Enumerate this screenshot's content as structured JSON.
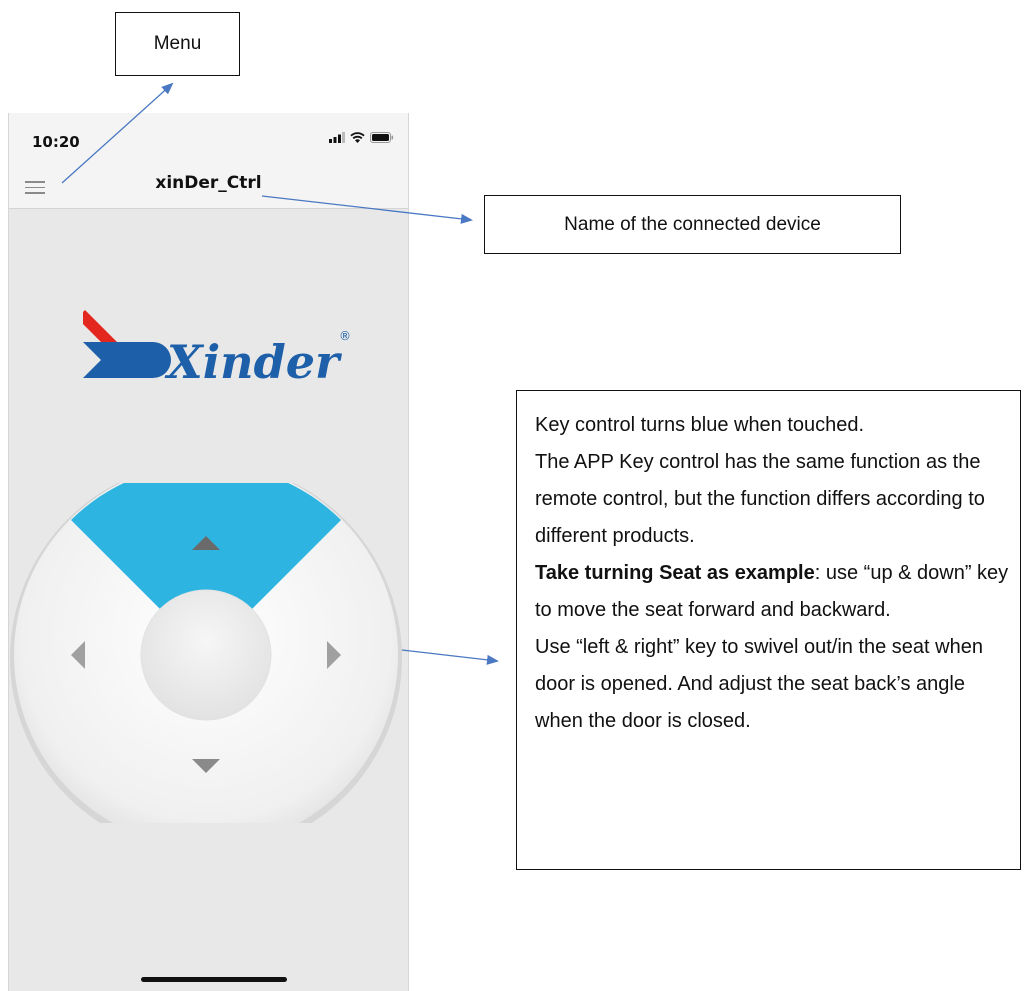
{
  "annotations": {
    "menu": "Menu",
    "device_name": "Name of the connected device",
    "key_info": {
      "line1": "Key control turns blue when touched.",
      "line2": "The APP Key control has the same function as the remote control, but the function differs according to different products.",
      "example_bold": "Take turning Seat as example",
      "example_rest": ": use “up & down” key to move the seat forward and backward.",
      "line4": "Use “left & right” key to swivel out/in the seat when door is opened. And adjust the seat back’s angle when the door is closed."
    }
  },
  "app": {
    "status_time": "10:20",
    "title": "xinDer_Ctrl",
    "logo_text": "Xinder",
    "logo_registered": "®",
    "dpad": {
      "active_key": "up",
      "active_color": "#2db4e0"
    }
  },
  "icons": [
    "menu-icon",
    "signal-icon",
    "wifi-icon",
    "battery-icon",
    "up-arrow-icon",
    "down-arrow-icon",
    "left-arrow-icon",
    "right-arrow-icon"
  ]
}
